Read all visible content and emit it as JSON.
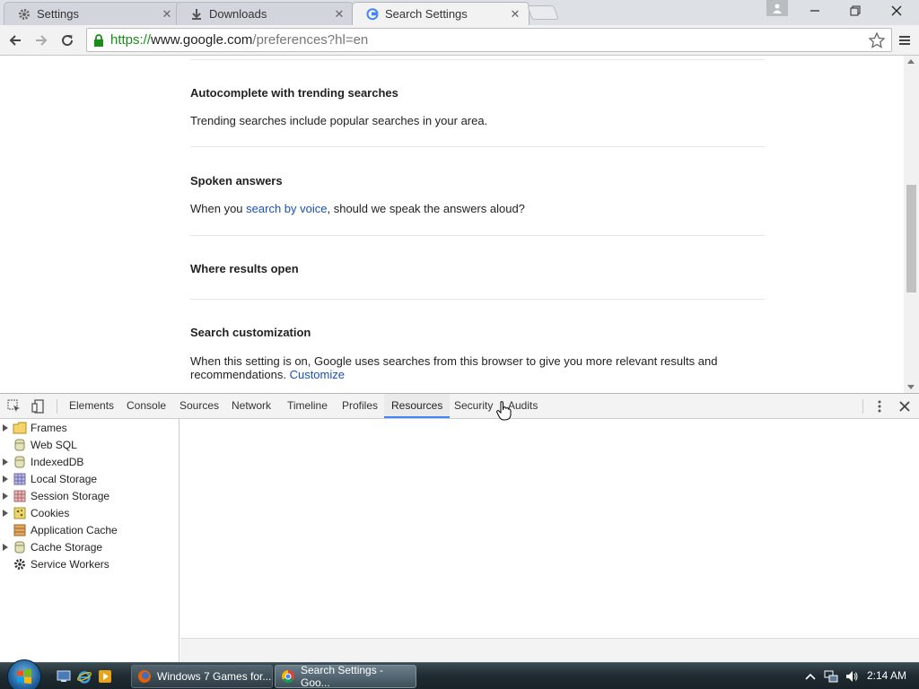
{
  "browser": {
    "tabs": [
      {
        "title": "Settings",
        "icon": "gear-icon",
        "active": false
      },
      {
        "title": "Downloads",
        "icon": "download-icon",
        "active": false
      },
      {
        "title": "Search Settings",
        "icon": "google-g-icon",
        "active": true
      }
    ],
    "address": {
      "scheme": "https://",
      "host": "www.google.com",
      "path": "/preferences?hl=en"
    }
  },
  "page": {
    "sections": [
      {
        "title": "Autocomplete with trending searches",
        "text": "Trending searches include popular searches in your area."
      },
      {
        "title": "Spoken answers",
        "text_before": "When you ",
        "link": "search by voice",
        "text_after": ", should we speak the answers aloud?"
      },
      {
        "title": "Where results open"
      },
      {
        "title": "Search customization",
        "text": "When this setting is on, Google uses searches from this browser to give you more relevant results and recommendations.",
        "link": "Customize"
      }
    ]
  },
  "devtools": {
    "tabs": [
      "Elements",
      "Console",
      "Sources",
      "Network",
      "Timeline",
      "Profiles",
      "Resources",
      "Security",
      "Audits"
    ],
    "active_tab": "Resources",
    "tree": [
      {
        "label": "Frames",
        "expandable": true,
        "icon": "folder-icon"
      },
      {
        "label": "Web SQL",
        "expandable": false,
        "icon": "database-icon"
      },
      {
        "label": "IndexedDB",
        "expandable": true,
        "icon": "database-icon"
      },
      {
        "label": "Local Storage",
        "expandable": true,
        "icon": "storage-grid-icon"
      },
      {
        "label": "Session Storage",
        "expandable": true,
        "icon": "storage-grid-icon"
      },
      {
        "label": "Cookies",
        "expandable": true,
        "icon": "cookie-icon"
      },
      {
        "label": "Application Cache",
        "expandable": false,
        "icon": "app-cache-icon"
      },
      {
        "label": "Cache Storage",
        "expandable": true,
        "icon": "database-icon"
      },
      {
        "label": "Service Workers",
        "expandable": false,
        "icon": "gear-icon"
      }
    ]
  },
  "taskbar": {
    "tasks": [
      {
        "title": "Windows 7 Games for...",
        "icon": "firefox-icon"
      },
      {
        "title": "Search Settings - Goo...",
        "icon": "chrome-icon",
        "active": true
      }
    ],
    "clock": "2:14 AM"
  },
  "colors": {
    "link": "#1a4fb8",
    "secure": "#1a8c1a",
    "devtools_active": "#3e82f7"
  }
}
